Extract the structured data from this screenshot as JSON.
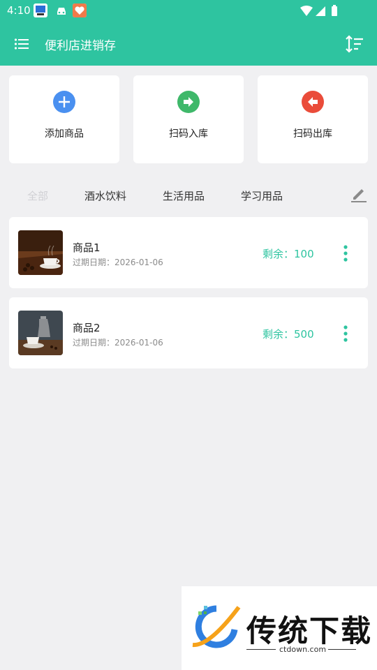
{
  "status_bar": {
    "time": "4:10"
  },
  "app_bar": {
    "title": "便利店进销存",
    "menu_icon": "menu-icon",
    "sort_icon": "sort-icon"
  },
  "actions": [
    {
      "label": "添加商品",
      "icon": "plus-icon",
      "color": "#4a90f0"
    },
    {
      "label": "扫码入库",
      "icon": "arrow-right-icon",
      "color": "#3fb86a"
    },
    {
      "label": "扫码出库",
      "icon": "arrow-left-icon",
      "color": "#ea4c3a"
    }
  ],
  "tabs": [
    {
      "label": "全部",
      "active": true
    },
    {
      "label": "酒水饮料",
      "active": false
    },
    {
      "label": "生活用品",
      "active": false
    },
    {
      "label": "学习用品",
      "active": false
    }
  ],
  "products": [
    {
      "name": "商品1",
      "expiry": "过期日期：2026-01-06",
      "remaining": "剩余：100"
    },
    {
      "name": "商品2",
      "expiry": "过期日期：2026-01-06",
      "remaining": "剩余：500"
    }
  ],
  "watermark": {
    "brand": "传统下载",
    "url": "ctdown.com"
  },
  "colors": {
    "primary": "#2ec4a0",
    "background": "#f0f0f2"
  }
}
